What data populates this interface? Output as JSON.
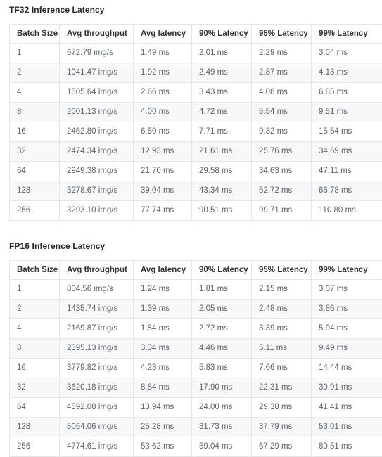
{
  "tables": [
    {
      "title": "TF32 Inference Latency",
      "columns": [
        "Batch Size",
        "Avg throughput",
        "Avg latency",
        "90% Latency",
        "95% Latency",
        "99% Latency"
      ],
      "rows": [
        [
          "1",
          "672.79 img/s",
          "1.49 ms",
          "2.01 ms",
          "2.29 ms",
          "3.04 ms"
        ],
        [
          "2",
          "1041.47 img/s",
          "1.92 ms",
          "2.49 ms",
          "2.87 ms",
          "4.13 ms"
        ],
        [
          "4",
          "1505.64 img/s",
          "2.66 ms",
          "3.43 ms",
          "4.06 ms",
          "6.85 ms"
        ],
        [
          "8",
          "2001.13 img/s",
          "4.00 ms",
          "4.72 ms",
          "5.54 ms",
          "9.51 ms"
        ],
        [
          "16",
          "2462.80 img/s",
          "6.50 ms",
          "7.71 ms",
          "9.32 ms",
          "15.54 ms"
        ],
        [
          "32",
          "2474.34 img/s",
          "12.93 ms",
          "21.61 ms",
          "25.76 ms",
          "34.69 ms"
        ],
        [
          "64",
          "2949.38 img/s",
          "21.70 ms",
          "29.58 ms",
          "34.63 ms",
          "47.11 ms"
        ],
        [
          "128",
          "3278.67 img/s",
          "39.04 ms",
          "43.34 ms",
          "52.72 ms",
          "66.78 ms"
        ],
        [
          "256",
          "3293.10 img/s",
          "77.74 ms",
          "90.51 ms",
          "99.71 ms",
          "110.80 ms"
        ]
      ]
    },
    {
      "title": "FP16 Inference Latency",
      "columns": [
        "Batch Size",
        "Avg throughput",
        "Avg latency",
        "90% Latency",
        "95% Latency",
        "99% Latency"
      ],
      "rows": [
        [
          "1",
          "804.56 img/s",
          "1.24 ms",
          "1.81 ms",
          "2.15 ms",
          "3.07 ms"
        ],
        [
          "2",
          "1435.74 img/s",
          "1.39 ms",
          "2.05 ms",
          "2.48 ms",
          "3.86 ms"
        ],
        [
          "4",
          "2169.87 img/s",
          "1.84 ms",
          "2.72 ms",
          "3.39 ms",
          "5.94 ms"
        ],
        [
          "8",
          "2395.13 img/s",
          "3.34 ms",
          "4.46 ms",
          "5.11 ms",
          "9.49 ms"
        ],
        [
          "16",
          "3779.82 img/s",
          "4.23 ms",
          "5.83 ms",
          "7.66 ms",
          "14.44 ms"
        ],
        [
          "32",
          "3620.18 img/s",
          "8.84 ms",
          "17.90 ms",
          "22.31 ms",
          "30.91 ms"
        ],
        [
          "64",
          "4592.08 img/s",
          "13.94 ms",
          "24.00 ms",
          "29.38 ms",
          "41.41 ms"
        ],
        [
          "128",
          "5064.06 img/s",
          "25.28 ms",
          "31.73 ms",
          "37.79 ms",
          "53.01 ms"
        ],
        [
          "256",
          "4774.61 img/s",
          "53.62 ms",
          "59.04 ms",
          "67.29 ms",
          "80.51 ms"
        ]
      ]
    }
  ],
  "colors": {
    "border": "#e3e6ea",
    "header_text": "#2f3337",
    "body_text": "#5b6268",
    "title_text": "#24292f",
    "stripe": "#f7f8f9"
  }
}
